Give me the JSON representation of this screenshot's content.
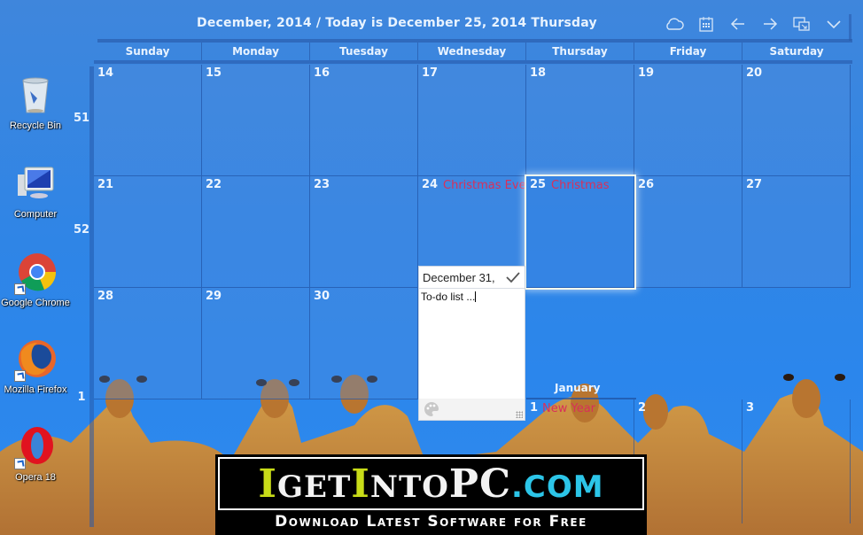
{
  "desktop": {
    "icons": [
      {
        "label": "Recycle Bin",
        "icon": "recycle-bin-icon",
        "shortcut": false
      },
      {
        "label": "Computer",
        "icon": "computer-icon",
        "shortcut": false
      },
      {
        "label": "Google Chrome",
        "icon": "chrome-icon",
        "shortcut": true
      },
      {
        "label": "Mozilla Firefox",
        "icon": "firefox-icon",
        "shortcut": true
      },
      {
        "label": "Opera 18",
        "icon": "opera-icon",
        "shortcut": true
      }
    ]
  },
  "calendar": {
    "title": "December, 2014 / Today is December 25, 2014 Thursday",
    "toolbar": [
      {
        "icon": "cloud-icon",
        "label": "Sync"
      },
      {
        "icon": "calendar-icon",
        "label": "Calendar"
      },
      {
        "icon": "arrow-left-icon",
        "label": "Previous"
      },
      {
        "icon": "arrow-right-icon",
        "label": "Next"
      },
      {
        "icon": "window-icon",
        "label": "Window mode"
      },
      {
        "icon": "chevron-down-icon",
        "label": "Menu"
      }
    ],
    "weekdays": [
      "Sunday",
      "Monday",
      "Tuesday",
      "Wednesday",
      "Thursday",
      "Friday",
      "Saturday"
    ],
    "week_numbers": [
      "51",
      "52",
      "1"
    ],
    "weeks": [
      [
        {
          "day": "14"
        },
        {
          "day": "15"
        },
        {
          "day": "16"
        },
        {
          "day": "17"
        },
        {
          "day": "18"
        },
        {
          "day": "19"
        },
        {
          "day": "20"
        }
      ],
      [
        {
          "day": "21"
        },
        {
          "day": "22"
        },
        {
          "day": "23"
        },
        {
          "day": "24",
          "holiday": "Christmas Eve"
        },
        {
          "day": "25",
          "holiday": "Christmas",
          "today": true
        },
        {
          "day": "26"
        },
        {
          "day": "27"
        }
      ],
      [
        {
          "day": "28"
        },
        {
          "day": "29"
        },
        {
          "day": "30"
        },
        {
          "day": ""
        },
        {
          "day": ""
        },
        {
          "day": ""
        },
        {
          "day": ""
        }
      ]
    ],
    "next_month": {
      "label": "January",
      "days": [
        {
          "day": "1",
          "holiday": "New Year"
        },
        {
          "day": "2"
        },
        {
          "day": "3"
        }
      ]
    },
    "colors": {
      "holiday": "#d8305a",
      "text": "#eef6ff",
      "today_border": "#f3f8ee"
    }
  },
  "todo_popup": {
    "date": "December 31,",
    "placeholder": "To-do list ...",
    "value": "",
    "confirm_icon": "check-icon",
    "color_icon": "palette-icon"
  },
  "banner": {
    "logo_parts": [
      "I",
      "GET",
      "I",
      "NTO",
      "PC",
      ".COM"
    ],
    "tagline": "Download Latest Software for Free"
  }
}
